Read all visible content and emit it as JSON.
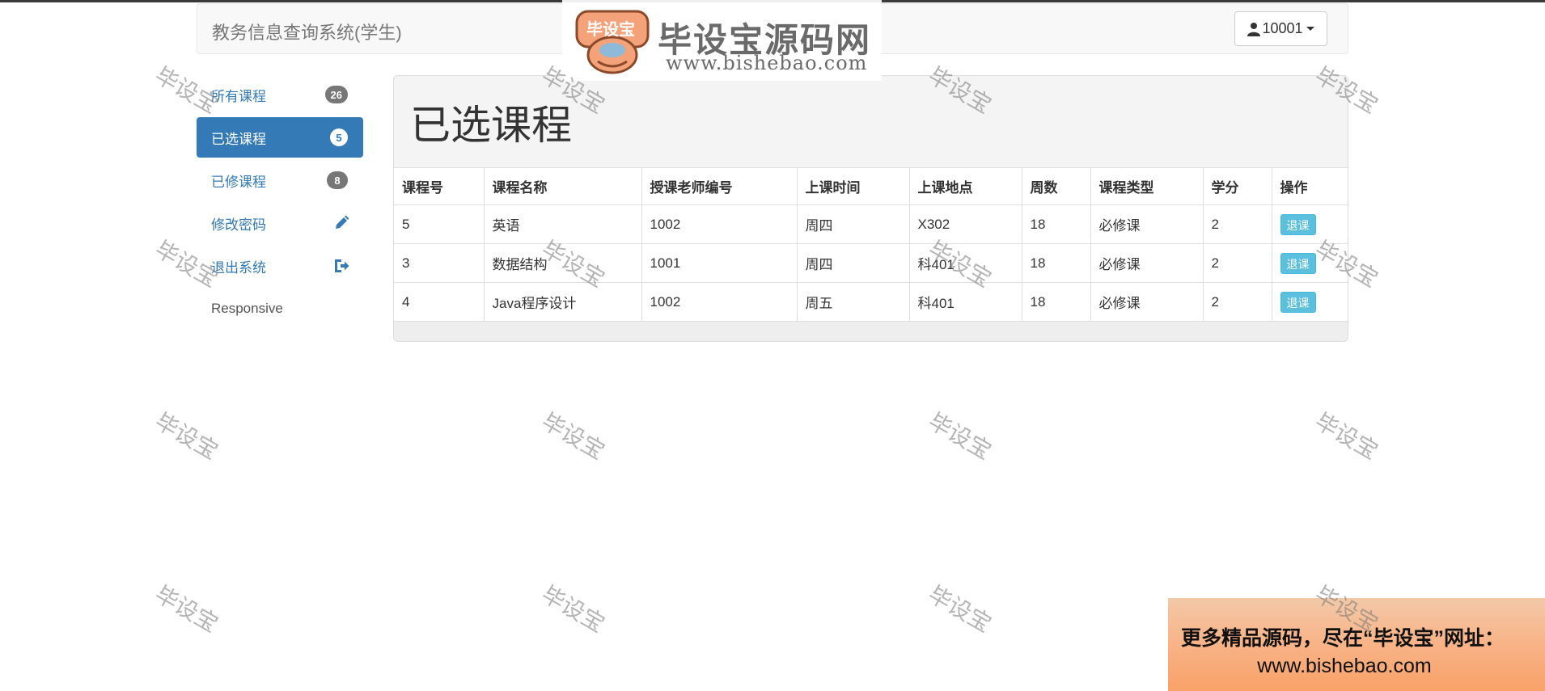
{
  "navbar": {
    "brand": "教务信息查询系统(学生)",
    "user_label": "10001"
  },
  "logo": {
    "badge_text": "毕设宝",
    "title": "毕设宝源码网",
    "url": "www.bishebao.com"
  },
  "sidebar": {
    "items": [
      {
        "label": "所有课程",
        "badge": "26"
      },
      {
        "label": "已选课程",
        "badge": "5"
      },
      {
        "label": "已修课程",
        "badge": "8"
      },
      {
        "label": "修改密码",
        "icon": "pencil-icon"
      },
      {
        "label": "退出系统",
        "icon": "logout-icon"
      }
    ],
    "footer_text": "Responsive"
  },
  "main": {
    "title": "已选课程",
    "table": {
      "headers": [
        "课程号",
        "课程名称",
        "授课老师编号",
        "上课时间",
        "上课地点",
        "周数",
        "课程类型",
        "学分",
        "操作"
      ],
      "rows": [
        [
          "5",
          "英语",
          "1002",
          "周四",
          "X302",
          "18",
          "必修课",
          "2"
        ],
        [
          "3",
          "数据结构",
          "1001",
          "周四",
          "科401",
          "18",
          "必修课",
          "2"
        ],
        [
          "4",
          "Java程序设计",
          "1002",
          "周五",
          "科401",
          "18",
          "必修课",
          "2"
        ]
      ],
      "action_label": "退课"
    }
  },
  "watermark_text": "毕设宝",
  "promo": {
    "line1": "更多精品源码，尽在“毕设宝”网址：",
    "line2": "www.bishebao.com"
  },
  "colors": {
    "primary": "#337ab7",
    "info_button": "#5bc0de",
    "badge": "#777777"
  }
}
